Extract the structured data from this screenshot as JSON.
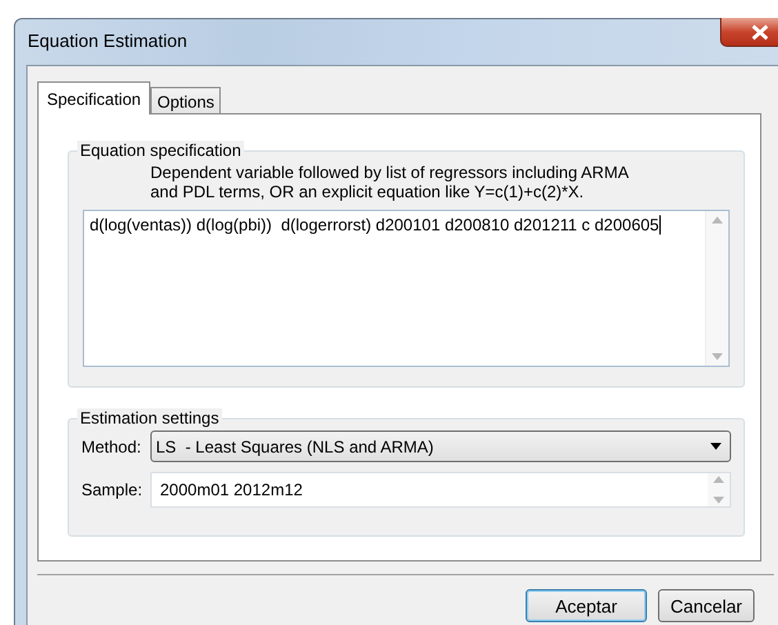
{
  "window": {
    "title": "Equation Estimation"
  },
  "tabs": [
    {
      "label": "Specification",
      "selected": true
    },
    {
      "label": "Options",
      "selected": false
    }
  ],
  "equation_specification": {
    "title": "Equation specification",
    "hint": "Dependent variable followed by list of regressors including ARMA and PDL terms, OR an explicit equation like Y=c(1)+c(2)*X.",
    "value": "d(log(ventas)) d(log(pbi))  d(logerrorst) d200101 d200810 d201211 c d200605"
  },
  "estimation_settings": {
    "title": "Estimation settings",
    "method": {
      "label": "Method:",
      "value": "LS  - Least Squares (NLS and ARMA)"
    },
    "sample": {
      "label": "Sample:",
      "value": "2000m01 2012m12"
    }
  },
  "buttons": [
    {
      "label": "Aceptar",
      "default": true
    },
    {
      "label": "Cancelar",
      "default": false
    }
  ]
}
